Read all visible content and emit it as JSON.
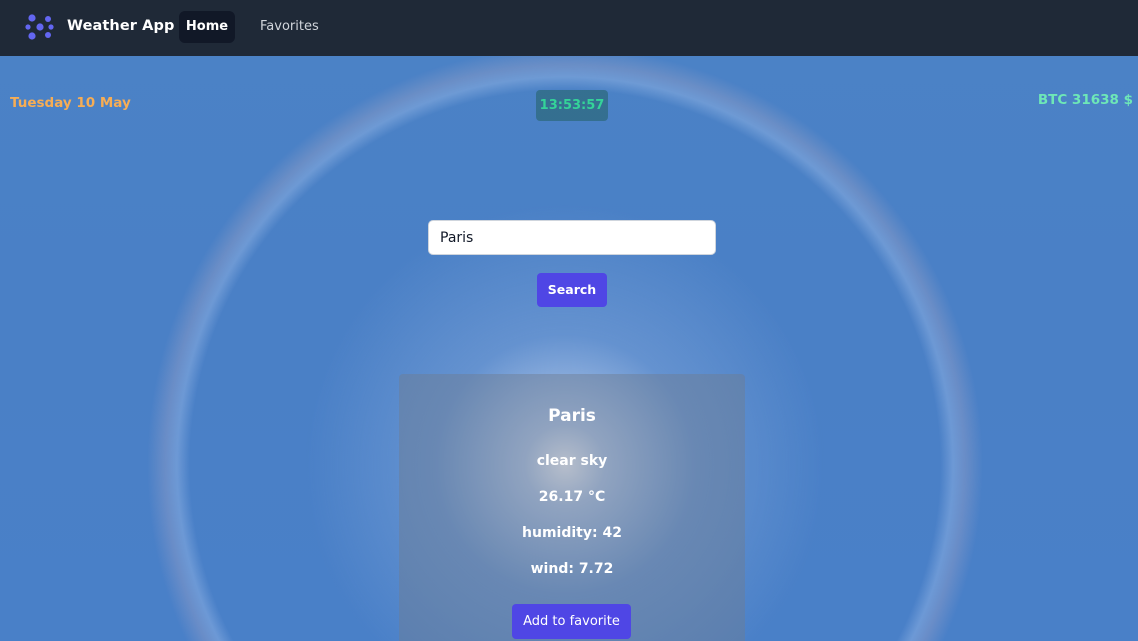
{
  "nav": {
    "brand": "Weather App",
    "home": "Home",
    "favorites": "Favorites",
    "logo_icon": "dots-logo-icon"
  },
  "info": {
    "date": "Tuesday 10 May",
    "time": "13:53:57",
    "btc": "BTC 31638 $"
  },
  "search": {
    "value": "Paris",
    "button": "Search"
  },
  "weather": {
    "city": "Paris",
    "description": "clear sky",
    "temperature": "26.17 °C",
    "humidity": "humidity: 42",
    "wind": "wind: 7.72",
    "favorite_button": "Add to favorite"
  },
  "colors": {
    "navbar": "#1f2937",
    "accent": "#4f46e5",
    "date": "#f6ad55",
    "clock": "#34d399",
    "btc": "#6ee7b7"
  }
}
